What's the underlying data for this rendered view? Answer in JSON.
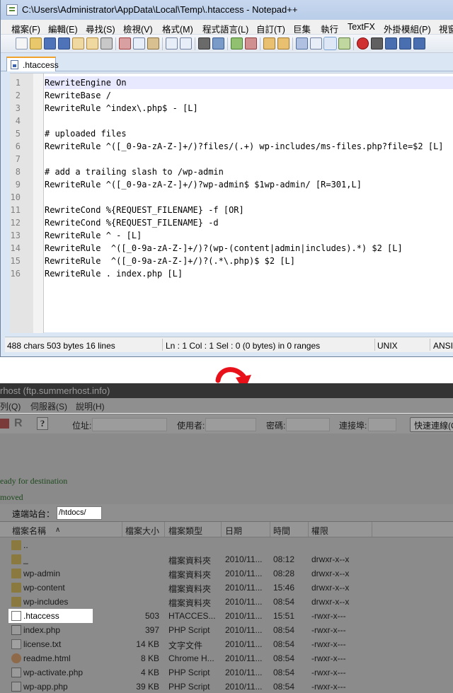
{
  "npp": {
    "title": "C:\\Users\\Administrator\\AppData\\Local\\Temp\\.htaccess - Notepad++",
    "menu": [
      "檔案(F)",
      "編輯(E)",
      "尋找(S)",
      "檢視(V)",
      "格式(M)",
      "程式語言(L)",
      "自訂(T)",
      "巨集",
      "執行",
      "TextFX",
      "外掛模組(P)",
      "視窗"
    ],
    "tab_label": ".htaccess",
    "lines": [
      {
        "num": "1",
        "text": "RewriteEngine On"
      },
      {
        "num": "2",
        "text": "RewriteBase /"
      },
      {
        "num": "3",
        "text": "RewriteRule ^index\\.php$ - [L]"
      },
      {
        "num": "4",
        "text": ""
      },
      {
        "num": "5",
        "text": "# uploaded files"
      },
      {
        "num": "6",
        "text": "RewriteRule ^([_0-9a-zA-Z-]+/)?files/(.+) wp-includes/ms-files.php?file=$2 [L]"
      },
      {
        "num": "7",
        "text": ""
      },
      {
        "num": "8",
        "text": "# add a trailing slash to /wp-admin"
      },
      {
        "num": "9",
        "text": "RewriteRule ^([_0-9a-zA-Z-]+/)?wp-admin$ $1wp-admin/ [R=301,L]"
      },
      {
        "num": "10",
        "text": ""
      },
      {
        "num": "11",
        "text": "RewriteCond %{REQUEST_FILENAME} -f [OR]"
      },
      {
        "num": "12",
        "text": "RewriteCond %{REQUEST_FILENAME} -d"
      },
      {
        "num": "13",
        "text": "RewriteRule ^ - [L]"
      },
      {
        "num": "14",
        "text": "RewriteRule  ^([_0-9a-zA-Z-]+/)?(wp-(content|admin|includes).*) $2 [L]"
      },
      {
        "num": "15",
        "text": "RewriteRule  ^([_0-9a-zA-Z-]+/)?(.*\\.php)$ $2 [L]"
      },
      {
        "num": "16",
        "text": "RewriteRule . index.php [L]"
      }
    ],
    "status": {
      "size": "488 chars   503 bytes   16 lines",
      "position": "Ln : 1    Col : 1    Sel : 0 (0 bytes) in 0 ranges",
      "eol": "UNIX",
      "encoding": "ANSI"
    }
  },
  "fz": {
    "title": "rhost (ftp.summerhost.info)",
    "menu": [
      "列(Q)",
      "伺服器(S)",
      "說明(H)"
    ],
    "quick": {
      "host_label": "位址:",
      "user_label": "使用者:",
      "pass_label": "密碼:",
      "port_label": "連接埠:",
      "connect_button": "快速連線(Q)"
    },
    "log": [
      "eady for destination",
      "moved"
    ],
    "remote_site_label": "遠端站台：",
    "remote_path": "/htdocs/",
    "headers": [
      "檔案名稱",
      "檔案大小",
      "檔案類型",
      "日期",
      "時間",
      "權限"
    ],
    "sort_indicator": "∧",
    "files": [
      {
        "name": "..",
        "size": "",
        "type": "",
        "date": "",
        "time": "",
        "perm": "",
        "icon": "folder"
      },
      {
        "name": "_",
        "size": "",
        "type": "檔案資料夾",
        "date": "2010/11...",
        "time": "08:12",
        "perm": "drwxr-x--x",
        "icon": "folder"
      },
      {
        "name": "wp-admin",
        "size": "",
        "type": "檔案資料夾",
        "date": "2010/11...",
        "time": "08:28",
        "perm": "drwxr-x--x",
        "icon": "folder"
      },
      {
        "name": "wp-content",
        "size": "",
        "type": "檔案資料夾",
        "date": "2010/11...",
        "time": "15:46",
        "perm": "drwxr-x--x",
        "icon": "folder"
      },
      {
        "name": "wp-includes",
        "size": "",
        "type": "檔案資料夾",
        "date": "2010/11...",
        "time": "08:54",
        "perm": "drwxr-x--x",
        "icon": "folder"
      },
      {
        "name": ".htaccess",
        "size": "503",
        "type": "HTACCES...",
        "date": "2010/11...",
        "time": "15:51",
        "perm": "-rwxr-x---",
        "icon": "white"
      },
      {
        "name": "index.php",
        "size": "397",
        "type": "PHP Script",
        "date": "2010/11...",
        "time": "08:54",
        "perm": "-rwxr-x---",
        "icon": "php"
      },
      {
        "name": "license.txt",
        "size": "14 KB",
        "type": "文字文件",
        "date": "2010/11...",
        "time": "08:54",
        "perm": "-rwxr-x---",
        "icon": "doc"
      },
      {
        "name": "readme.html",
        "size": "8 KB",
        "type": "Chrome H...",
        "date": "2010/11...",
        "time": "08:54",
        "perm": "-rwxr-x---",
        "icon": "chrome"
      },
      {
        "name": "wp-activate.php",
        "size": "4 KB",
        "type": "PHP Script",
        "date": "2010/11...",
        "time": "08:54",
        "perm": "-rwxr-x---",
        "icon": "php"
      },
      {
        "name": "wp-app.php",
        "size": "39 KB",
        "type": "PHP Script",
        "date": "2010/11...",
        "time": "08:54",
        "perm": "-rwxr-x---",
        "icon": "php"
      }
    ]
  },
  "colors": {
    "arrow": "#e8111a",
    "npp_current_line": "#e8e8ff",
    "fz_log_text": "#1f4a1f"
  }
}
